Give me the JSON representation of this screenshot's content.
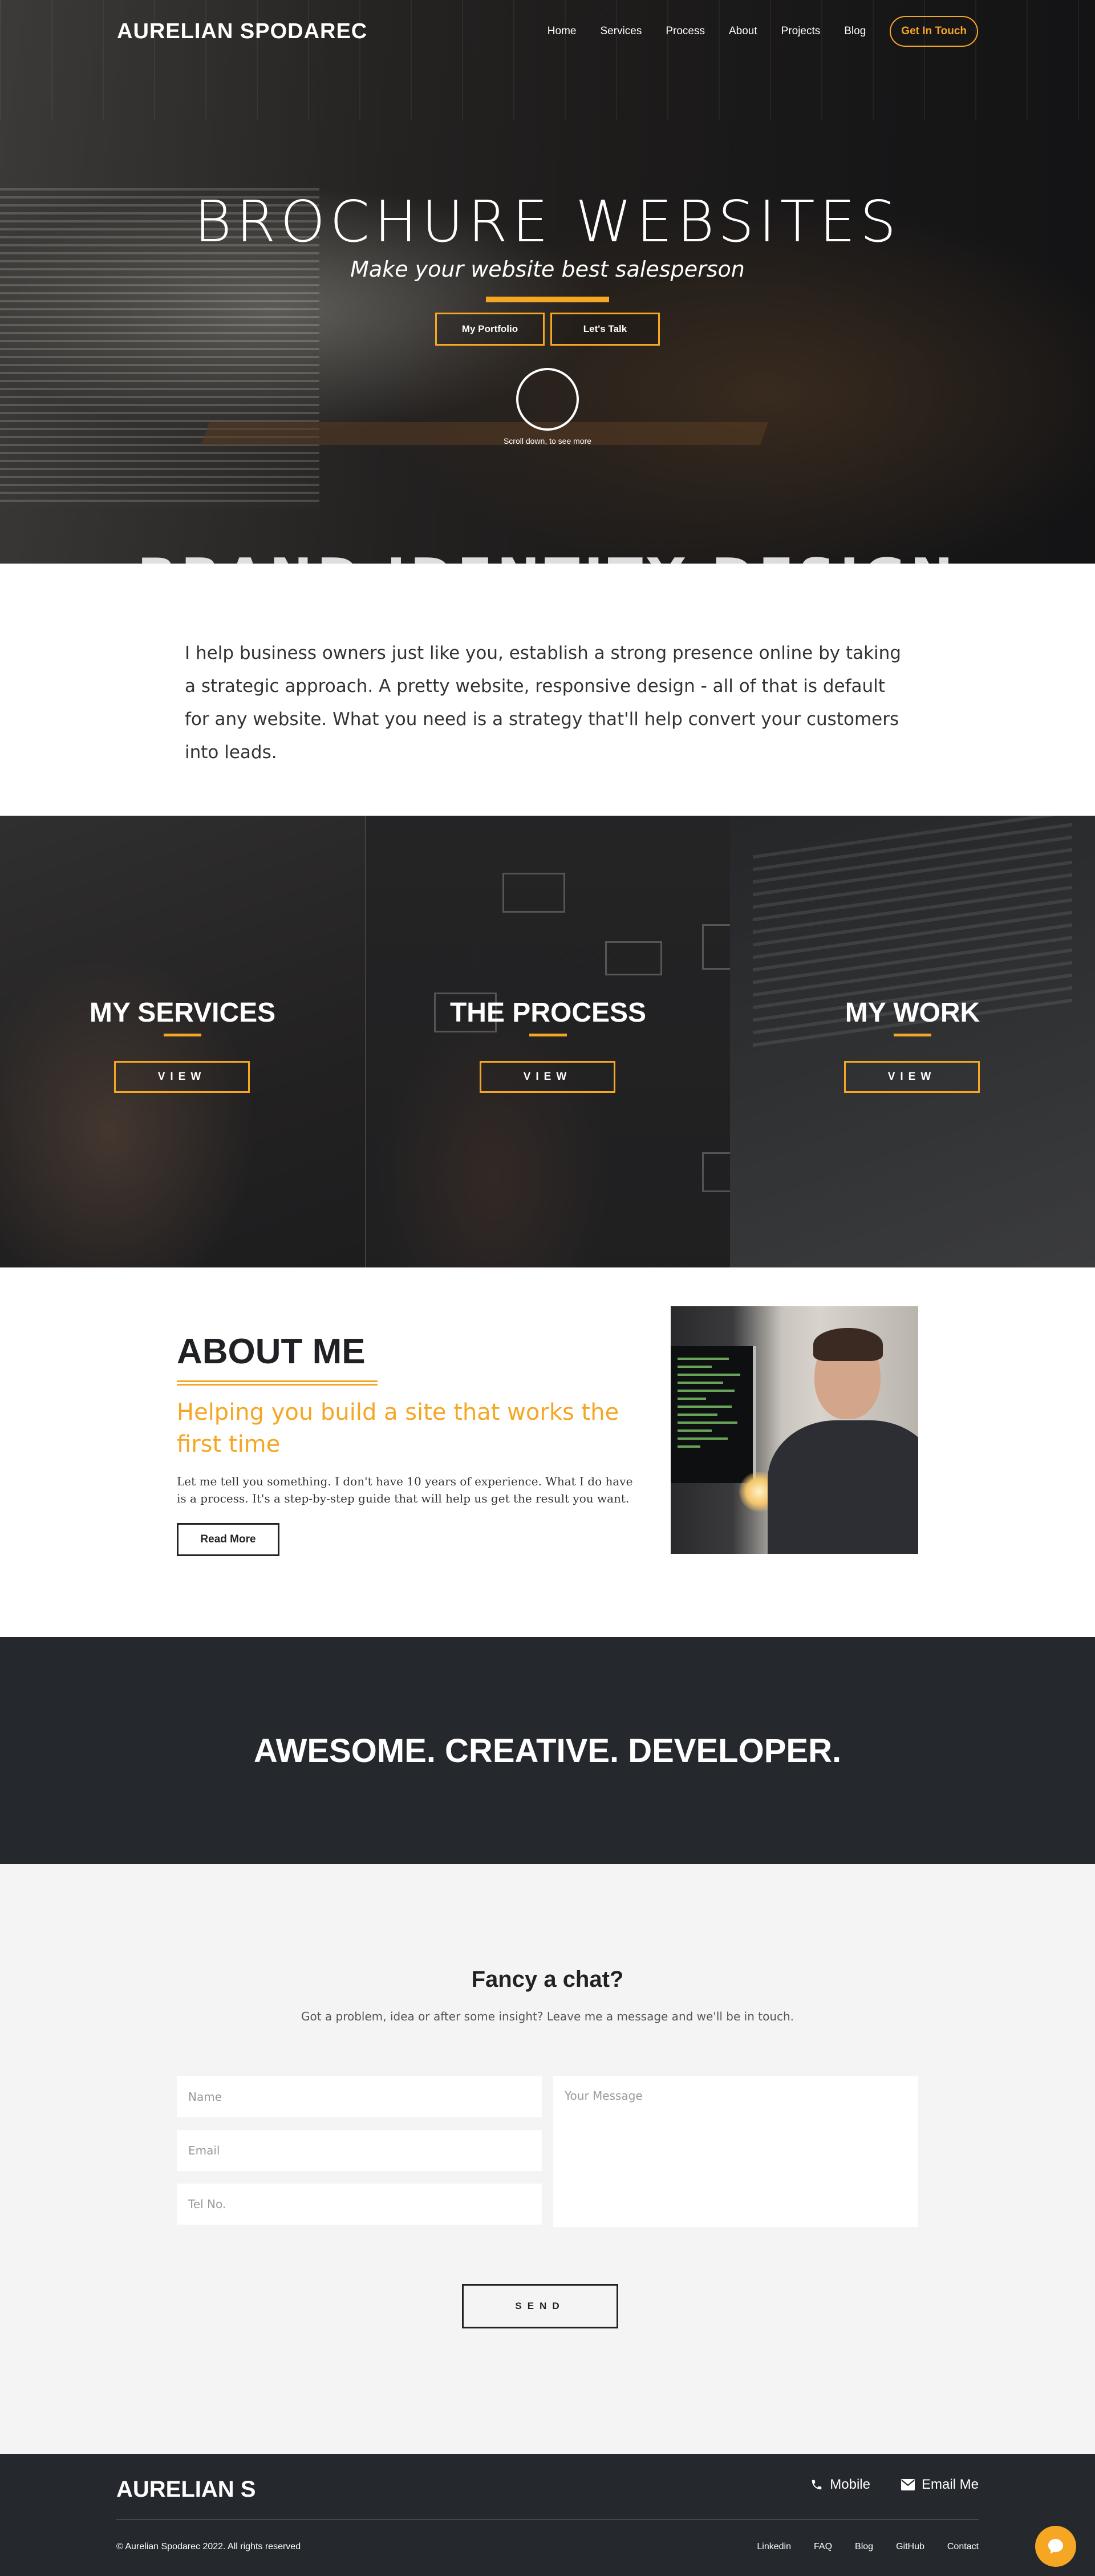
{
  "brand": "AURELIAN SPODAREC",
  "nav": {
    "items": [
      "Home",
      "Services",
      "Process",
      "About",
      "Projects",
      "Blog"
    ],
    "cta": "Get In Touch"
  },
  "hero": {
    "title": "BROCHURE WEBSITES",
    "subtitle": "Make your website best salesperson",
    "btn_portfolio": "My Portfolio",
    "btn_talk": "Let's Talk",
    "scroll_hint": "Scroll down, to see more",
    "ghost_text": "BRAND IDENTITY DESIGN"
  },
  "intro": {
    "text": "I help business owners just like you, establish a strong presence online by taking a strategic approach. A pretty website, responsive design - all of that is default for any website. What you need is a strategy that'll help convert your customers into leads."
  },
  "panels": [
    {
      "title": "MY SERVICES",
      "button": "VIEW"
    },
    {
      "title": "THE PROCESS",
      "button": "VIEW"
    },
    {
      "title": "MY WORK",
      "button": "VIEW"
    }
  ],
  "about": {
    "heading": "ABOUT ME",
    "subheading": "Helping you build a site that works the first time",
    "body": "Let me tell you something. I don't have 10 years of experience. What I do have is a process. It's a step-by-step guide that will help us get the result you want.",
    "button": "Read More"
  },
  "tagline": "AWESOME. CREATIVE. DEVELOPER.",
  "contact": {
    "heading": "Fancy a chat?",
    "lead": "Got a problem, idea or after some insight? Leave me a message and we'll be in touch.",
    "name_placeholder": "Name",
    "email_placeholder": "Email",
    "tel_placeholder": "Tel No.",
    "message_placeholder": "Your Message",
    "send": "SEND"
  },
  "footer": {
    "brand": "AURELIAN S",
    "mobile": "Mobile",
    "email": "Email Me",
    "copyright": "© Aurelian Spodarec 2022. All rights reserved",
    "links": [
      "Linkedin",
      "FAQ",
      "Blog",
      "GitHub",
      "Contact"
    ]
  },
  "colors": {
    "accent": "#f5a623",
    "dark": "#25282d",
    "light_bg": "#f4f4f4"
  },
  "icons": {
    "mobile": "phone-icon",
    "email": "envelope-icon",
    "chat": "chat-bubble-icon"
  }
}
